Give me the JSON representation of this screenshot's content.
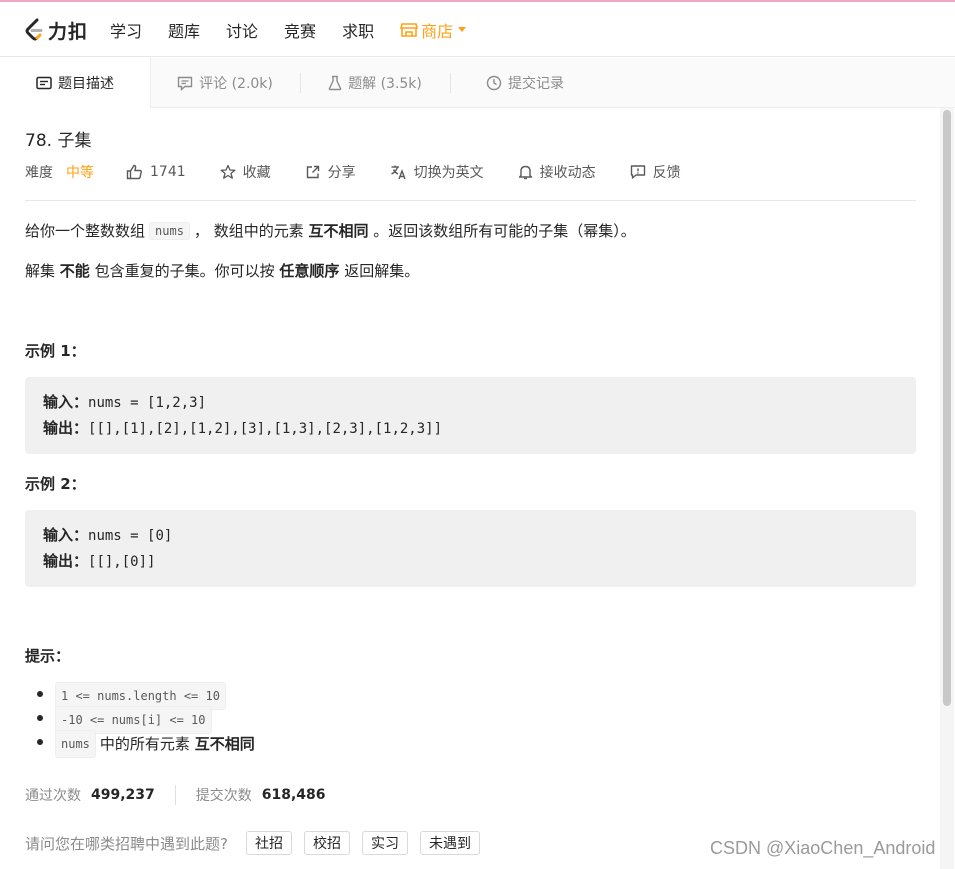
{
  "nav": {
    "logo_text": "力扣",
    "items": [
      "学习",
      "题库",
      "讨论",
      "竞赛",
      "求职"
    ],
    "store_label": "商店"
  },
  "tabs": [
    {
      "label": "题目描述",
      "icon": "description-icon"
    },
    {
      "label": "评论 (2.0k)",
      "icon": "comment-icon"
    },
    {
      "label": "题解 (3.5k)",
      "icon": "flask-icon"
    },
    {
      "label": "提交记录",
      "icon": "clock-icon"
    }
  ],
  "problem": {
    "title": "78. 子集",
    "difficulty_label": "难度",
    "difficulty_value": "中等",
    "likes": "1741",
    "favorite_label": "收藏",
    "share_label": "分享",
    "translate_label": "切换为英文",
    "notify_label": "接收动态",
    "feedback_label": "反馈"
  },
  "description": {
    "p1_a": "给你一个整数数组",
    "p1_code": "nums",
    "p1_b": "， 数组中的元素",
    "p1_bold": "互不相同",
    "p1_c": "。返回该数组所有可能的子集（幂集）。",
    "p2_a": "解集",
    "p2_bold1": "不能",
    "p2_b": "包含重复的子集。你可以按",
    "p2_bold2": "任意顺序",
    "p2_c": "返回解集。"
  },
  "examples": [
    {
      "heading": "示例 1：",
      "input_label": "输入：",
      "input": "nums = [1,2,3]",
      "output_label": "输出：",
      "output": "[[],[1],[2],[1,2],[3],[1,3],[2,3],[1,2,3]]"
    },
    {
      "heading": "示例 2：",
      "input_label": "输入：",
      "input": "nums = [0]",
      "output_label": "输出：",
      "output": "[[],[0]]"
    }
  ],
  "hints": {
    "heading": "提示：",
    "items": [
      "1 <= nums.length <= 10",
      "-10 <= nums[i] <= 10"
    ],
    "item3_code": "nums",
    "item3_text": "中的所有元素",
    "item3_bold": "互不相同"
  },
  "stats": {
    "accepted_label": "通过次数",
    "accepted_value": "499,237",
    "submitted_label": "提交次数",
    "submitted_value": "618,486"
  },
  "survey": {
    "question": "请问您在哪类招聘中遇到此题?",
    "options": [
      "社招",
      "校招",
      "实习",
      "未遇到"
    ]
  },
  "watermark": "CSDN @XiaoChen_Android",
  "colors": {
    "accent": "#ffa116",
    "text": "#262626",
    "muted": "#8c8c8c"
  }
}
